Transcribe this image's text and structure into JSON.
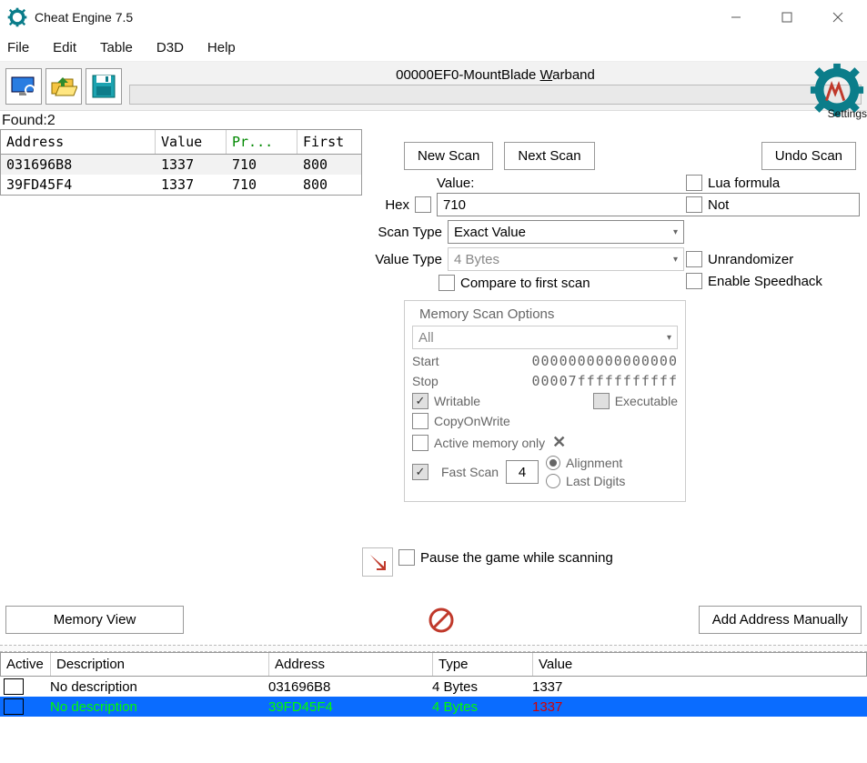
{
  "window": {
    "title": "Cheat Engine 7.5"
  },
  "menubar": [
    "File",
    "Edit",
    "Table",
    "D3D",
    "Help"
  ],
  "process": {
    "label": "00000EF0-MountBlade Warband",
    "underline_char_index": 20
  },
  "settings_label": "Settings",
  "found": {
    "label": "Found:",
    "count": "2"
  },
  "results": {
    "headers": {
      "address": "Address",
      "value": "Value",
      "previous": "Pr...",
      "first": "First"
    },
    "rows": [
      {
        "address": "031696B8",
        "value": "1337",
        "previous": "710",
        "first": "800"
      },
      {
        "address": "39FD45F4",
        "value": "1337",
        "previous": "710",
        "first": "800"
      }
    ]
  },
  "scan": {
    "new": "New Scan",
    "next": "Next Scan",
    "undo": "Undo Scan",
    "value_label": "Value:",
    "hex_label": "Hex",
    "value": "710",
    "scan_type_label": "Scan Type",
    "scan_type": "Exact Value",
    "value_type_label": "Value Type",
    "value_type": "4 Bytes",
    "compare": "Compare to first scan",
    "lua": "Lua formula",
    "not": "Not",
    "unrandomizer": "Unrandomizer",
    "speedhack": "Enable Speedhack"
  },
  "mso": {
    "legend": "Memory Scan Options",
    "region": "All",
    "start_label": "Start",
    "start": "0000000000000000",
    "stop_label": "Stop",
    "stop": "00007fffffffffff",
    "writable": "Writable",
    "executable": "Executable",
    "cow": "CopyOnWrite",
    "active_mem": "Active memory only",
    "fastscan": "Fast Scan",
    "fastscan_val": "4",
    "alignment": "Alignment",
    "lastdigits": "Last Digits"
  },
  "pause": "Pause the game while scanning",
  "bottom": {
    "memview": "Memory View",
    "addman": "Add Address Manually"
  },
  "cheattable": {
    "headers": {
      "active": "Active",
      "desc": "Description",
      "address": "Address",
      "type": "Type",
      "value": "Value"
    },
    "rows": [
      {
        "desc": "No description",
        "address": "031696B8",
        "type": "4 Bytes",
        "value": "1337",
        "selected": false
      },
      {
        "desc": "No description",
        "address": "39FD45F4",
        "type": "4 Bytes",
        "value": "1337",
        "selected": true
      }
    ]
  }
}
